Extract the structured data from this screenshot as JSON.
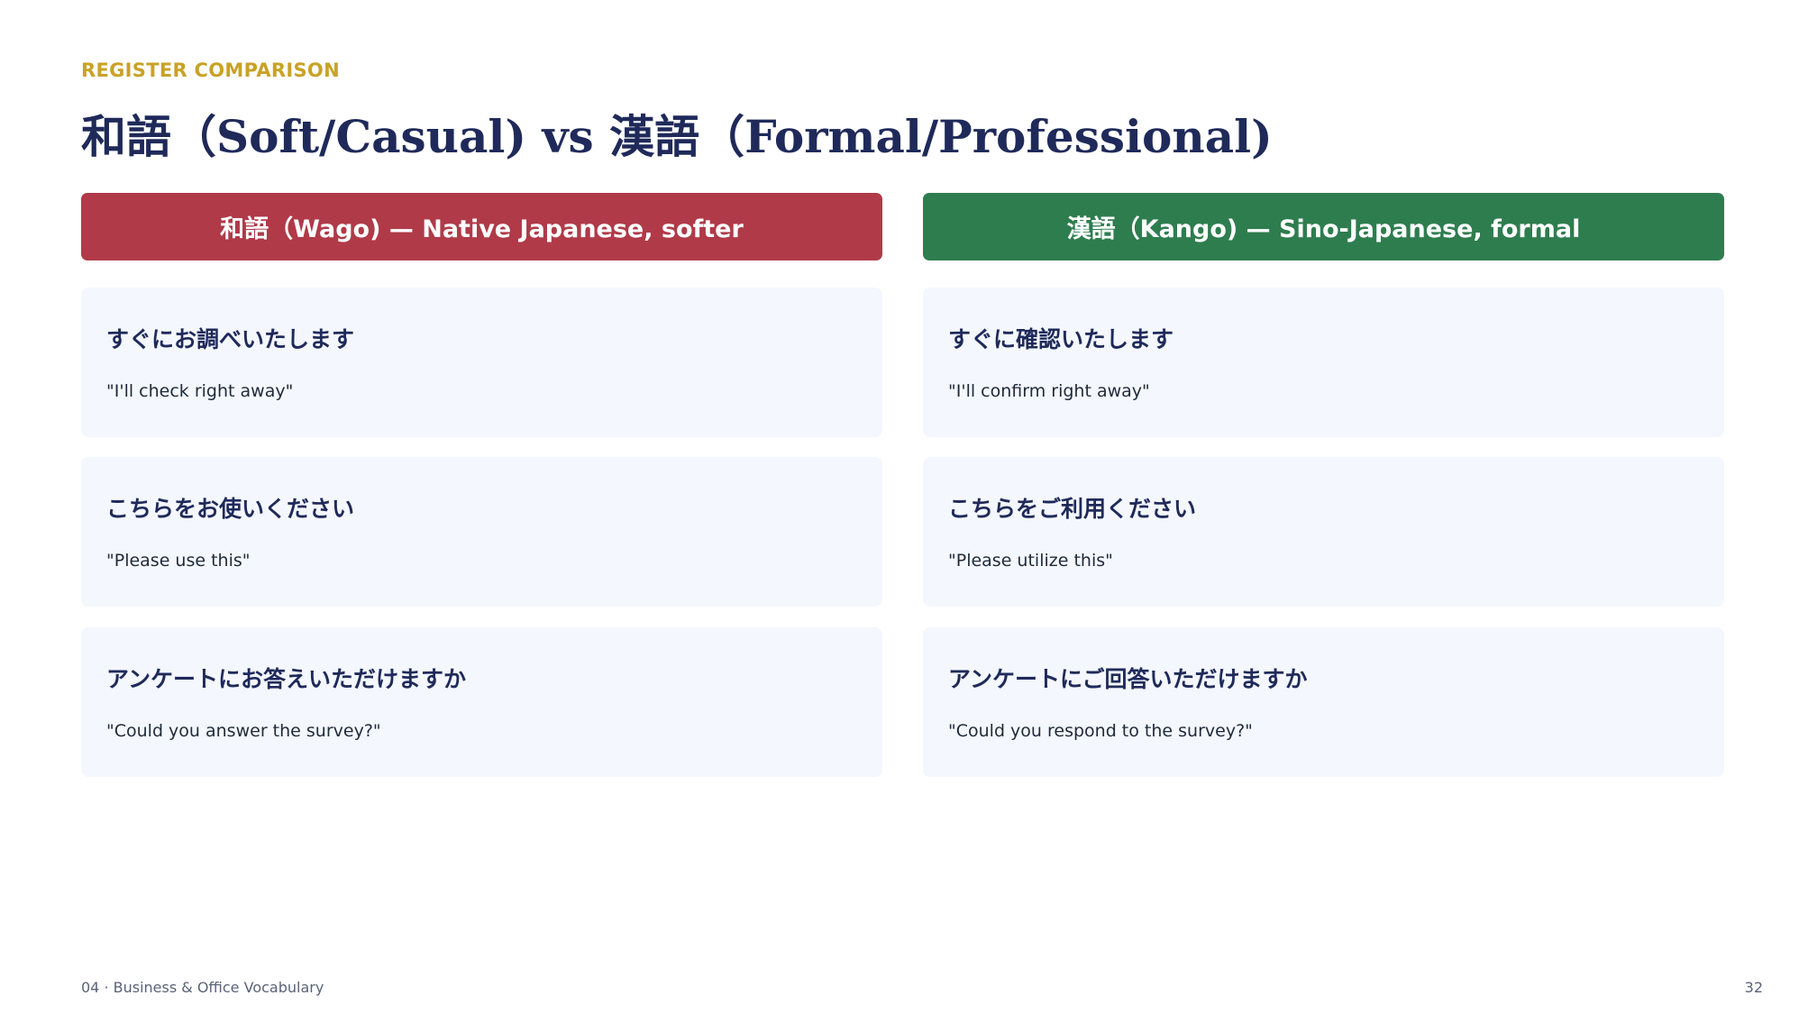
{
  "header": {
    "eyebrow": "REGISTER COMPARISON",
    "title": "和語（Soft/Casual) vs 漢語（Formal/Professional)"
  },
  "columns": [
    {
      "header": "和語（Wago) — Native Japanese, softer",
      "color": "#b03a48",
      "items": [
        {
          "jp": "すぐにお調べいたします",
          "en": "\"I'll check right away\""
        },
        {
          "jp": "こちらをお使いください",
          "en": "\"Please use this\""
        },
        {
          "jp": "アンケートにお答えいただけますか",
          "en": "\"Could you answer the survey?\""
        }
      ]
    },
    {
      "header": "漢語（Kango) — Sino-Japanese, formal",
      "color": "#2e7d4f",
      "items": [
        {
          "jp": "すぐに確認いたします",
          "en": "\"I'll confirm right away\""
        },
        {
          "jp": "こちらをご利用ください",
          "en": "\"Please utilize this\""
        },
        {
          "jp": "アンケートにご回答いただけますか",
          "en": "\"Could you respond to the survey?\""
        }
      ]
    }
  ],
  "footer": {
    "section": "04 · Business & Office Vocabulary",
    "page": "32"
  }
}
